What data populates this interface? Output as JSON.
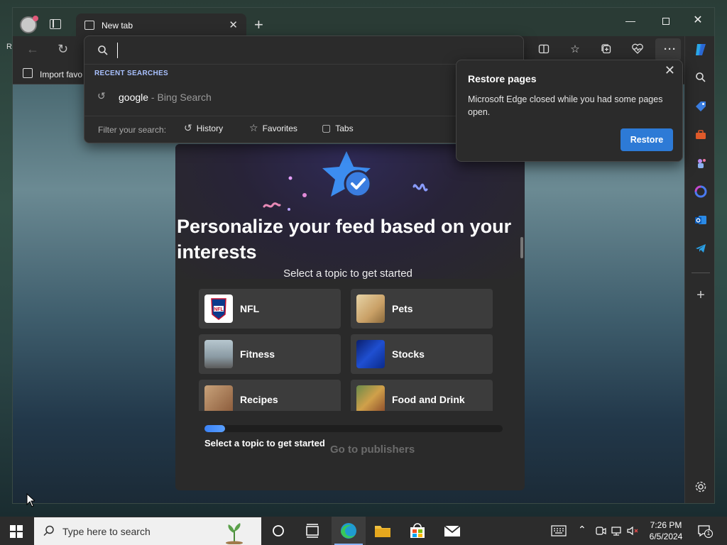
{
  "browser": {
    "tab_title": "New tab",
    "import_favorites_label": "Import favo",
    "address": {
      "value": "",
      "recent_label": "RECENT SEARCHES",
      "recent": [
        {
          "term": "google",
          "source": " - Bing Search"
        }
      ],
      "filter_label": "Filter your search:",
      "filters": [
        {
          "label": "History",
          "icon": "history-icon"
        },
        {
          "label": "Favorites",
          "icon": "star-icon"
        },
        {
          "label": "Tabs",
          "icon": "tabs-icon"
        }
      ]
    },
    "restore": {
      "title": "Restore pages",
      "message": "Microsoft Edge closed while you had some pages open.",
      "button": "Restore"
    }
  },
  "feed": {
    "heading": "Personalize your feed based on your interests",
    "subheading": "Select a topic to get started",
    "topics": [
      {
        "label": "NFL"
      },
      {
        "label": "Pets"
      },
      {
        "label": "Fitness"
      },
      {
        "label": "Stocks"
      },
      {
        "label": "Recipes"
      },
      {
        "label": "Food and Drink"
      }
    ],
    "progress_label": "Select a topic to get started",
    "progress_fraction": 0.07,
    "go_button": "Go to publishers"
  },
  "sidebar": {
    "items": [
      "search-icon",
      "shopping-tag-icon",
      "tools-icon",
      "games-icon",
      "microsoft-365-icon",
      "outlook-icon",
      "telegram-icon",
      "add-icon",
      "settings-icon"
    ]
  },
  "taskbar": {
    "search_placeholder": "Type here to search",
    "time": "7:26 PM",
    "date": "6/5/2024",
    "notification_count": "1"
  },
  "colors": {
    "accent": "#2d7ad6",
    "recent_label": "#a9c1ff"
  }
}
